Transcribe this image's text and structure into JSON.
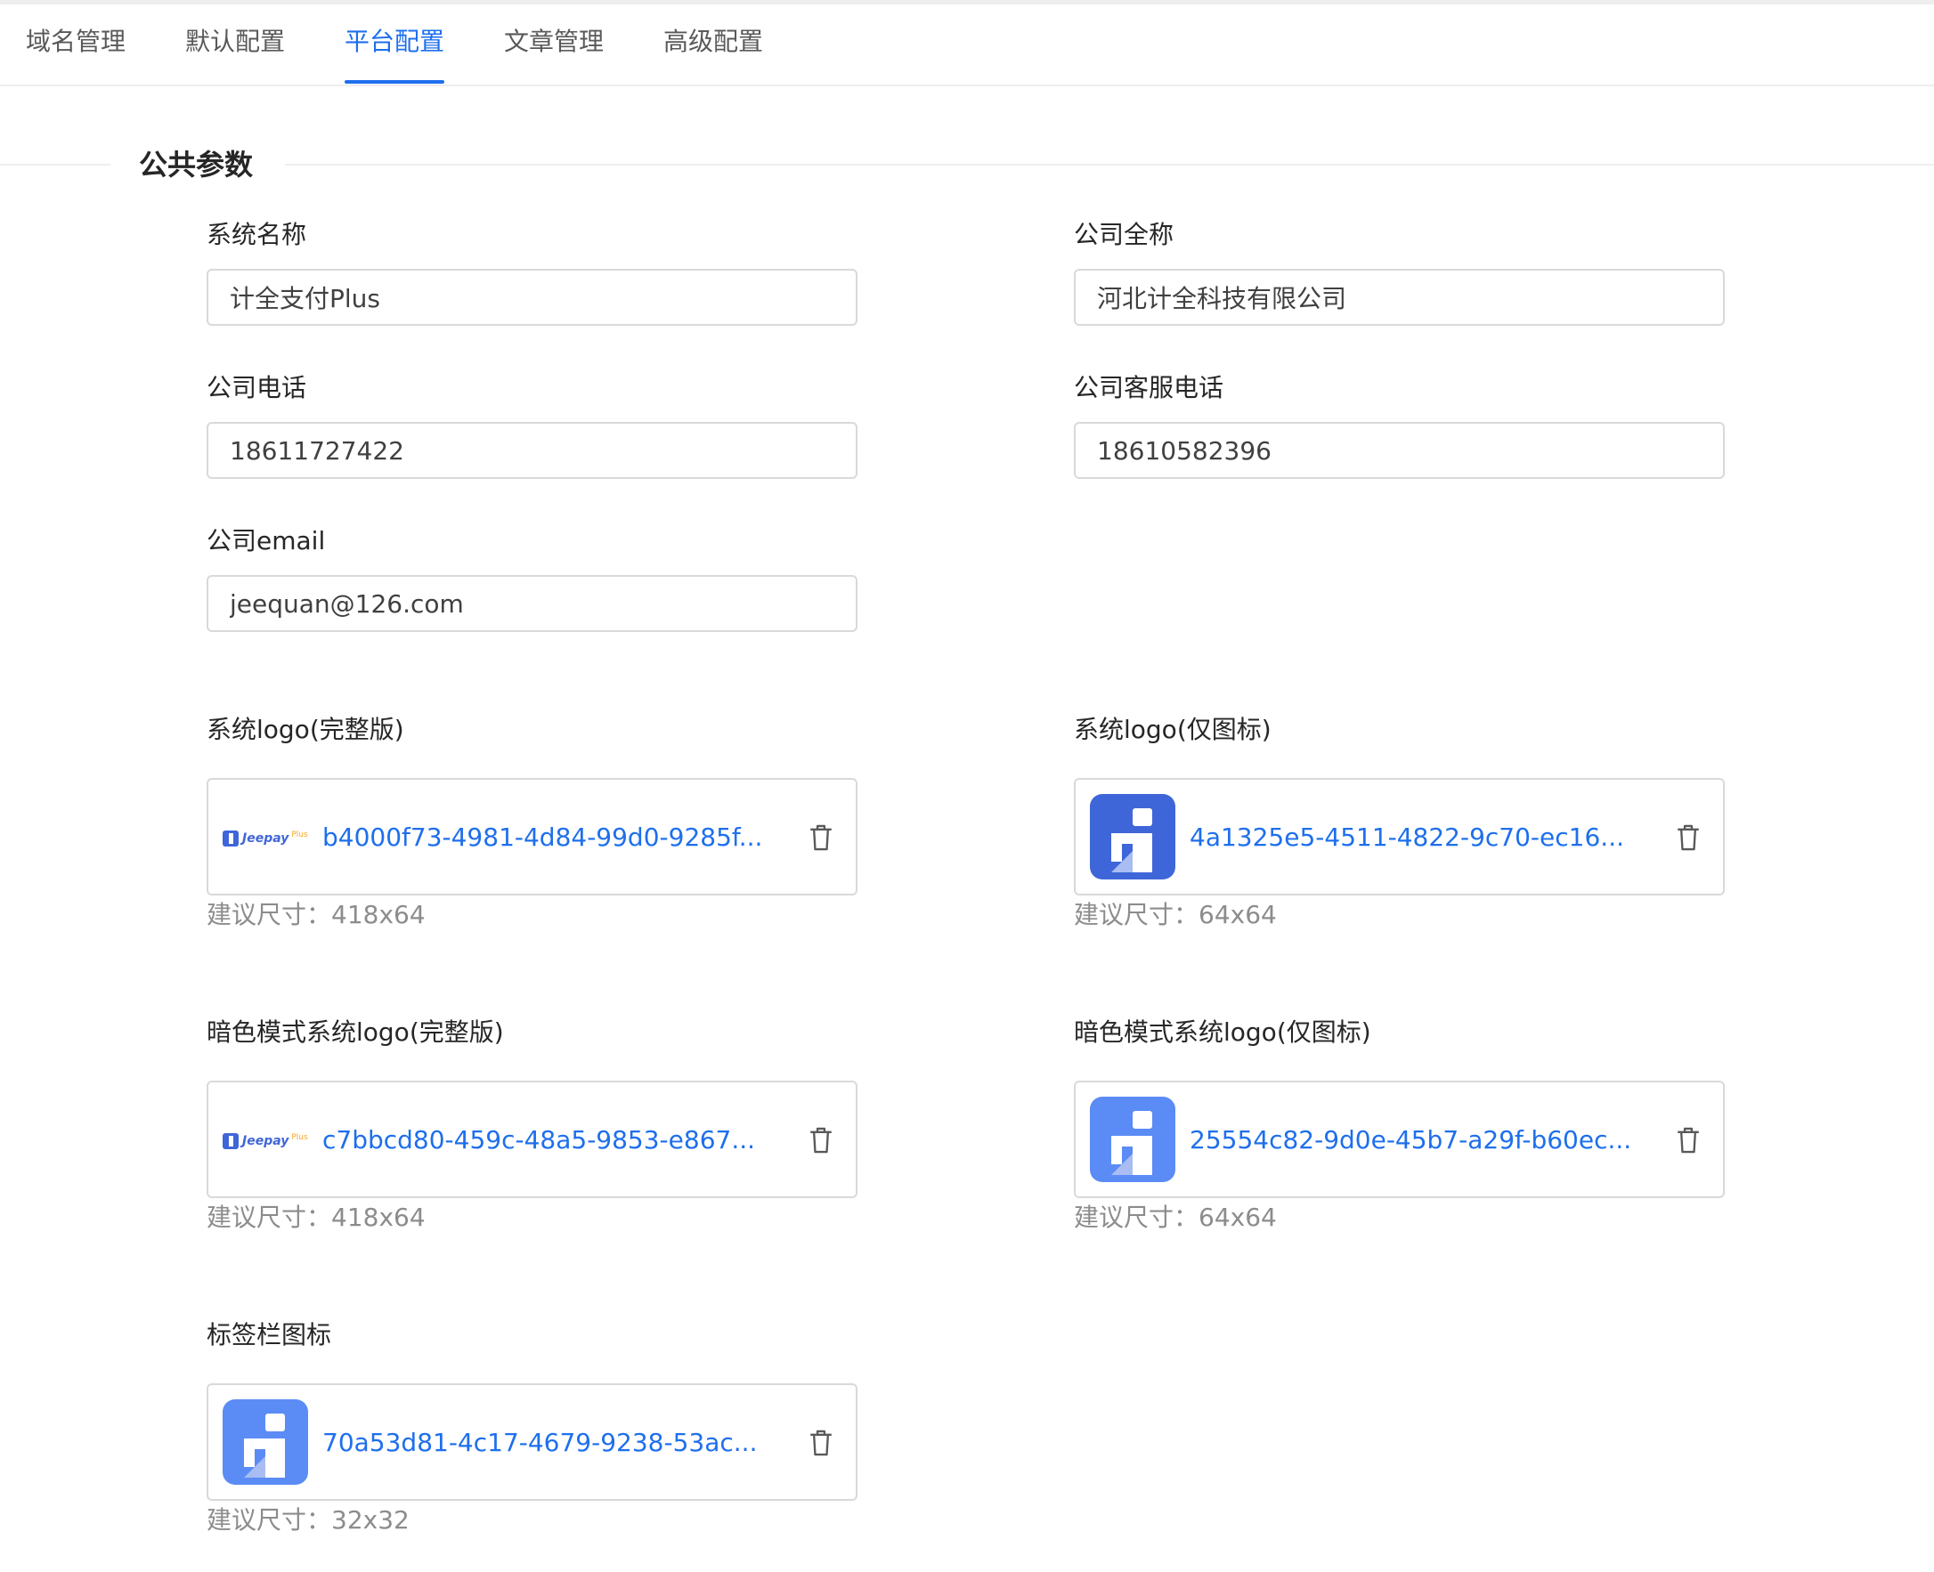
{
  "tabs": [
    {
      "label": "域名管理"
    },
    {
      "label": "默认配置"
    },
    {
      "label": "平台配置",
      "active": true
    },
    {
      "label": "文章管理"
    },
    {
      "label": "高级配置"
    }
  ],
  "section": {
    "title": "公共参数"
  },
  "fields": {
    "system_name": {
      "label": "系统名称",
      "value": "计全支付Plus"
    },
    "company_full_name": {
      "label": "公司全称",
      "value": "河北计全科技有限公司"
    },
    "company_phone": {
      "label": "公司电话",
      "value": "18611727422"
    },
    "company_service_phone": {
      "label": "公司客服电话",
      "value": "18610582396"
    },
    "company_email": {
      "label": "公司email",
      "value": "jeequan@126.com"
    }
  },
  "uploads": {
    "logo_full": {
      "label": "系统logo(完整版)",
      "file": "b4000f73-4981-4d84-99d0-9285f...",
      "hint": "建议尺寸：418x64",
      "thumb": "jeepay-wordmark",
      "thumb_text": "Jeepay",
      "thumb_sup": "Plus"
    },
    "logo_icon": {
      "label": "系统logo(仅图标)",
      "file": "4a1325e5-4511-4822-9c70-ec16...",
      "hint": "建议尺寸：64x64",
      "thumb": "jeepay-icon",
      "thumb_color": "#3f66d8"
    },
    "dark_logo_full": {
      "label": "暗色模式系统logo(完整版)",
      "file": "c7bbcd80-459c-48a5-9853-e867...",
      "hint": "建议尺寸：418x64",
      "thumb": "jeepay-wordmark",
      "thumb_text": "Jeepay",
      "thumb_sup": "Plus"
    },
    "dark_logo_icon": {
      "label": "暗色模式系统logo(仅图标)",
      "file": "25554c82-9d0e-45b7-a29f-b60ec...",
      "hint": "建议尺寸：64x64",
      "thumb": "jeepay-icon",
      "thumb_color": "#5b8bf5"
    },
    "favicon": {
      "label": "标签栏图标",
      "file": "70a53d81-4c17-4679-9238-53ac...",
      "hint": "建议尺寸：32x32",
      "thumb": "jeepay-icon",
      "thumb_color": "#5b8bf5"
    }
  },
  "colors": {
    "accent": "#1e6fec",
    "border": "#d9d9d9",
    "hint_text": "#8c8c8c"
  }
}
